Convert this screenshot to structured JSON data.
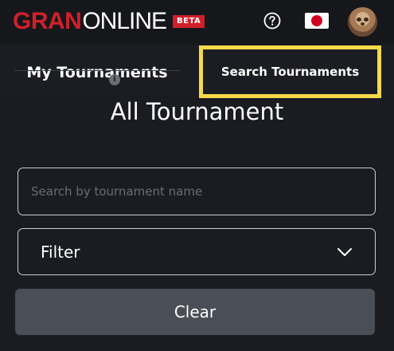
{
  "header": {
    "logo_primary": "GRAN",
    "logo_secondary": "ONLINE",
    "logo_badge": "BETA",
    "help_icon": "question-circle-icon",
    "language_flag": "japan-flag-icon",
    "avatar_icon": "sloth-avatar"
  },
  "tabs": [
    {
      "label": "My Tournaments",
      "selected": false
    },
    {
      "label": "Search Tournaments",
      "selected": true,
      "highlighted": true
    }
  ],
  "info_badge": "i",
  "page": {
    "title": "All Tournament"
  },
  "search": {
    "placeholder": "Search by tournament name",
    "value": ""
  },
  "filter": {
    "label": "Filter",
    "icon": "chevron-down-icon"
  },
  "clear_button": {
    "label": "Clear"
  },
  "colors": {
    "background": "#1a1c21",
    "brand_red": "#d0202a",
    "highlight": "#f5d94a",
    "button_gray": "#4a4e56"
  }
}
